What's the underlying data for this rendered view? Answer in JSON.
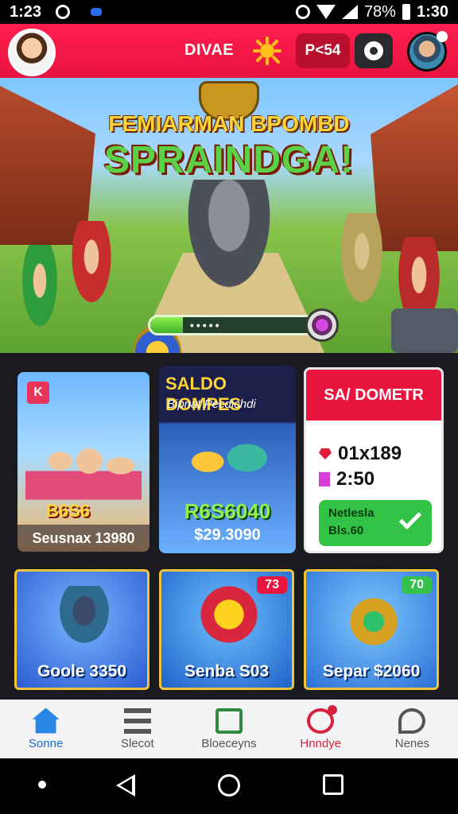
{
  "status_bar": {
    "time_left": "1:23",
    "battery_percent": "78%",
    "time_right": "1:30"
  },
  "header": {
    "title": "DIVAE",
    "coin_label": "P<54"
  },
  "hero": {
    "title_line1": "FEMIARMAN BPOMBD",
    "title_line2": "SPRAINDGA!",
    "progress": 0.2
  },
  "cards": {
    "card1": {
      "tag": "K",
      "badge_text": "B6S6",
      "label": "Seusnax 13980"
    },
    "card2": {
      "title": "SALDO DOMPES",
      "subtitle": "Bipnat Pecdichdi",
      "big_text": "R6S6040",
      "label": "$29.3090"
    },
    "card3": {
      "title": "SA/ DOMETR",
      "value1": "01x189",
      "value2": "2:50",
      "claim_line1": "Netlesla",
      "claim_line2": "Bls.60"
    }
  },
  "shop": [
    {
      "label": "Goole 3350",
      "badge": ""
    },
    {
      "label": "Senba S03",
      "badge": "73"
    },
    {
      "label": "Separ $2060",
      "badge": "70"
    }
  ],
  "bottom_nav": [
    {
      "label": "Sonne"
    },
    {
      "label": "Slecot"
    },
    {
      "label": "Bloeceyns"
    },
    {
      "label": "Hnndye"
    },
    {
      "label": "Nenes"
    }
  ],
  "colors": {
    "header": "#e9153f",
    "accent_green": "#32c246",
    "nav_active": "#1c6fd1"
  }
}
